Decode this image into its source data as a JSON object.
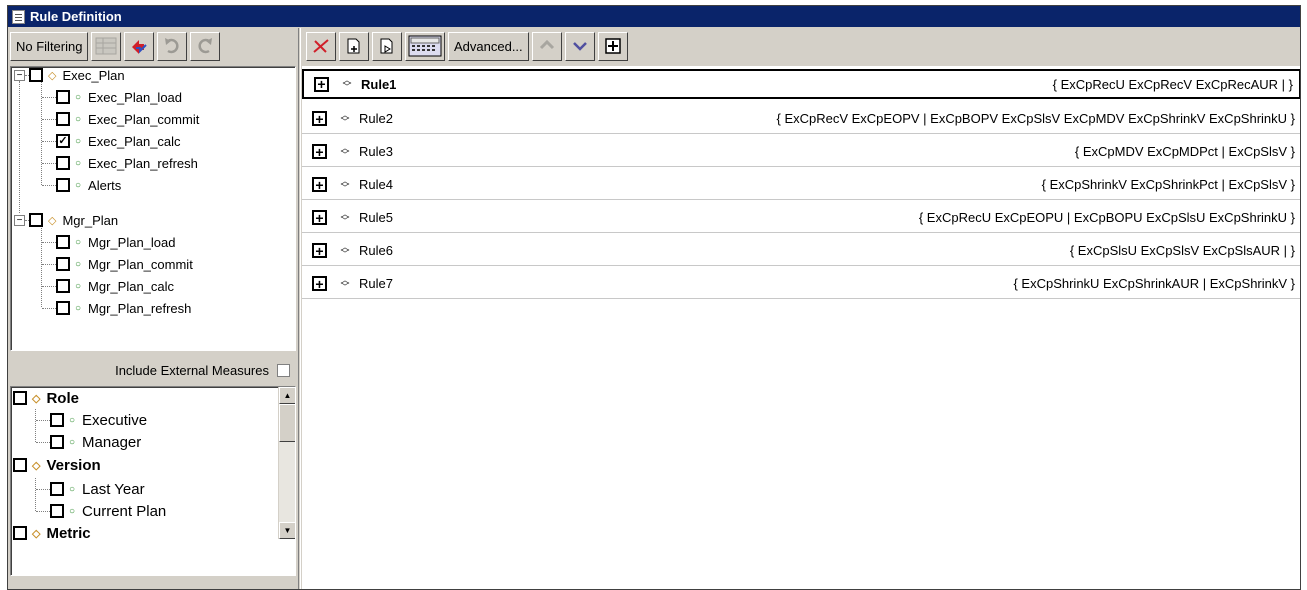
{
  "window": {
    "title": "Rule Definition"
  },
  "toolbar_left": {
    "filter_label": "No Filtering",
    "buttons": [
      "filter-grid-icon",
      "swap-icon",
      "redo-icon",
      "refresh-icon"
    ]
  },
  "toolbar_right": {
    "advanced_label": "Advanced...",
    "buttons": [
      "delete-icon",
      "add-rule-icon",
      "edit-rule-icon",
      "calculator-icon",
      "move-up-icon",
      "move-down-icon",
      "expand-all-icon"
    ]
  },
  "tree": {
    "groups": [
      {
        "label": "Exec_Plan",
        "checked": false,
        "items": [
          {
            "label": "Exec_Plan_load",
            "checked": false
          },
          {
            "label": "Exec_Plan_commit",
            "checked": false
          },
          {
            "label": "Exec_Plan_calc",
            "checked": true
          },
          {
            "label": "Exec_Plan_refresh",
            "checked": false
          },
          {
            "label": "Alerts",
            "checked": false
          }
        ]
      },
      {
        "label": "Mgr_Plan",
        "checked": false,
        "items": [
          {
            "label": "Mgr_Plan_load",
            "checked": false
          },
          {
            "label": "Mgr_Plan_commit",
            "checked": false
          },
          {
            "label": "Mgr_Plan_calc",
            "checked": false
          },
          {
            "label": "Mgr_Plan_refresh",
            "checked": false
          }
        ]
      }
    ]
  },
  "external": {
    "label": "Include External Measures",
    "checked": false
  },
  "dimensions": [
    {
      "label": "Role",
      "items": [
        "Executive",
        "Manager"
      ]
    },
    {
      "label": "Version",
      "items": [
        "Last Year",
        "Current Plan"
      ]
    },
    {
      "label": "Metric",
      "items": []
    }
  ],
  "rules": [
    {
      "name": "Rule1",
      "expr": "{ ExCpRecU ExCpRecV ExCpRecAUR | }",
      "selected": true
    },
    {
      "name": "Rule2",
      "expr": "{ ExCpRecV ExCpEOPV | ExCpBOPV ExCpSlsV ExCpMDV ExCpShrinkV ExCpShrinkU }",
      "selected": false
    },
    {
      "name": "Rule3",
      "expr": "{ ExCpMDV ExCpMDPct | ExCpSlsV }",
      "selected": false
    },
    {
      "name": "Rule4",
      "expr": "{ ExCpShrinkV ExCpShrinkPct | ExCpSlsV }",
      "selected": false
    },
    {
      "name": "Rule5",
      "expr": "{ ExCpRecU ExCpEOPU | ExCpBOPU ExCpSlsU ExCpShrinkU }",
      "selected": false
    },
    {
      "name": "Rule6",
      "expr": "{ ExCpSlsU ExCpSlsV ExCpSlsAUR | }",
      "selected": false
    },
    {
      "name": "Rule7",
      "expr": "{ ExCpShrinkU ExCpShrinkAUR | ExCpShrinkV }",
      "selected": false
    }
  ]
}
